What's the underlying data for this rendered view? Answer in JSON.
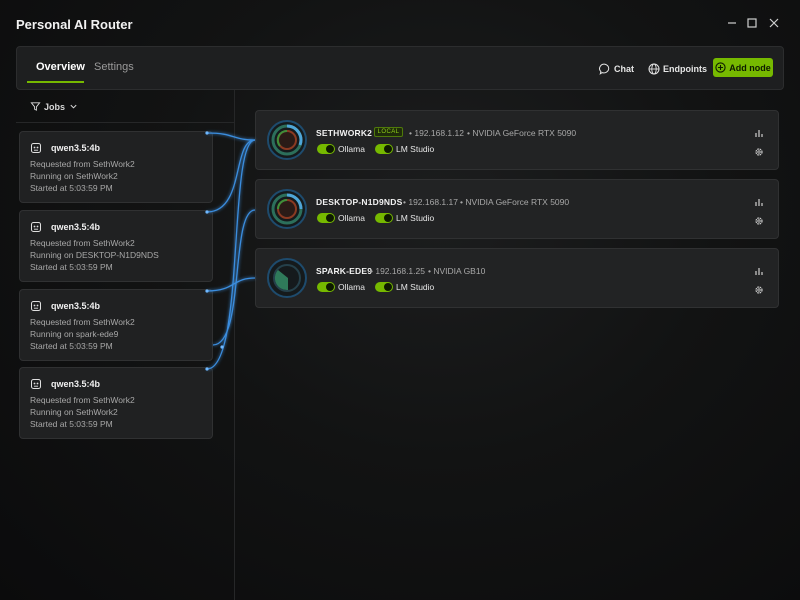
{
  "app": {
    "title": "Personal AI Router"
  },
  "tabs": [
    {
      "label": "Overview",
      "active": true
    },
    {
      "label": "Settings",
      "active": false
    }
  ],
  "toolbar": {
    "chat_label": "Chat",
    "endpoints_label": "Endpoints",
    "add_node_label": "Add node"
  },
  "jobs": {
    "filter_label": "Jobs",
    "items": [
      {
        "model": "qwen3.5:4b",
        "requested": "Requested from SethWork2",
        "running": "Running on SethWork2",
        "started": "Started at 5:03:59 PM"
      },
      {
        "model": "qwen3.5:4b",
        "requested": "Requested from SethWork2",
        "running": "Running on DESKTOP-N1D9NDS",
        "started": "Started at 5:03:59 PM"
      },
      {
        "model": "qwen3.5:4b",
        "requested": "Requested from SethWork2",
        "running": "Running on spark-ede9",
        "started": "Started at 5:03:59 PM"
      },
      {
        "model": "qwen3.5:4b",
        "requested": "Requested from SethWork2",
        "running": "Running on SethWork2",
        "started": "Started at 5:03:59 PM"
      }
    ]
  },
  "nodes": [
    {
      "name": "SETHWORK2",
      "badge": "LOCAL",
      "ip": "• 192.168.1.12",
      "gpu": "• NVIDIA GeForce RTX 5090",
      "backends": [
        "Ollama",
        "LM Studio"
      ]
    },
    {
      "name": "DESKTOP-N1D9NDS",
      "badge": "",
      "ip": "• 192.168.1.17",
      "gpu": "• NVIDIA GeForce RTX 5090",
      "backends": [
        "Ollama",
        "LM Studio"
      ]
    },
    {
      "name": "SPARK-EDE9",
      "badge": "",
      "ip": "• 192.168.1.25",
      "gpu": "• NVIDIA GB10",
      "backends": [
        "Ollama",
        "LM Studio"
      ]
    }
  ],
  "colors": {
    "accent": "#76b900",
    "wire": "#3a8dde"
  }
}
